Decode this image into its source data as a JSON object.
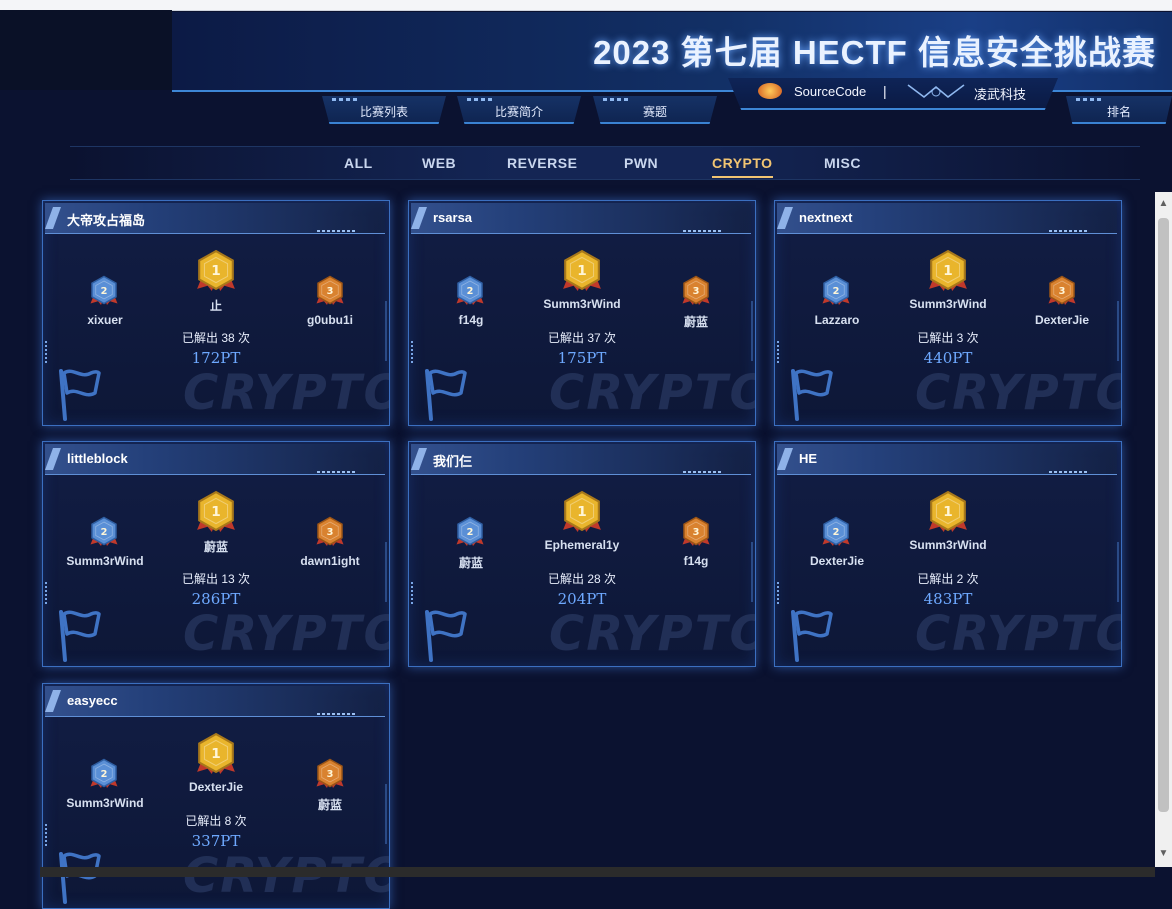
{
  "header": {
    "title": "2023 第七届 HECTF 信息安全挑战赛",
    "sponsors": [
      "SourceCode",
      "|",
      "凌武科技"
    ]
  },
  "nav": {
    "tabs": [
      "比赛列表",
      "比赛简介",
      "赛题",
      "排名"
    ]
  },
  "categories": {
    "items": [
      "ALL",
      "WEB",
      "REVERSE",
      "PWN",
      "CRYPTO",
      "MISC"
    ],
    "active": "CRYPTO"
  },
  "challenges": [
    {
      "name": "大帝攻占福岛",
      "first": "止",
      "second": "xixuer",
      "third": "g0ubu1i",
      "solves": "已解出 38 次",
      "points": "172PT"
    },
    {
      "name": "rsarsa",
      "first": "Summ3rWind",
      "second": "f14g",
      "third": "蔚蓝",
      "solves": "已解出 37 次",
      "points": "175PT"
    },
    {
      "name": "nextnext",
      "first": "Summ3rWind",
      "second": "Lazzaro",
      "third": "DexterJie",
      "solves": "已解出 3 次",
      "points": "440PT"
    },
    {
      "name": "littleblock",
      "first": "蔚蓝",
      "second": "Summ3rWind",
      "third": "dawn1ight",
      "solves": "已解出 13 次",
      "points": "286PT"
    },
    {
      "name": "我们仨",
      "first": "Ephemeral1y",
      "second": "蔚蓝",
      "third": "f14g",
      "solves": "已解出 28 次",
      "points": "204PT"
    },
    {
      "name": "HE",
      "first": "Summ3rWind",
      "second": "DexterJie",
      "third": "",
      "solves": "已解出 2 次",
      "points": "483PT"
    },
    {
      "name": "easyecc",
      "first": "DexterJie",
      "second": "Summ3rWind",
      "third": "蔚蓝",
      "solves": "已解出 8 次",
      "points": "337PT"
    }
  ],
  "watermark": "CRYPTO",
  "medal_ranks": [
    "1",
    "2",
    "3"
  ],
  "colors": {
    "accent": "#f2c572",
    "points": "#6ea9ff",
    "gold": "#e9b52c",
    "silver": "#5a8fd6",
    "bronze": "#d9822f"
  }
}
